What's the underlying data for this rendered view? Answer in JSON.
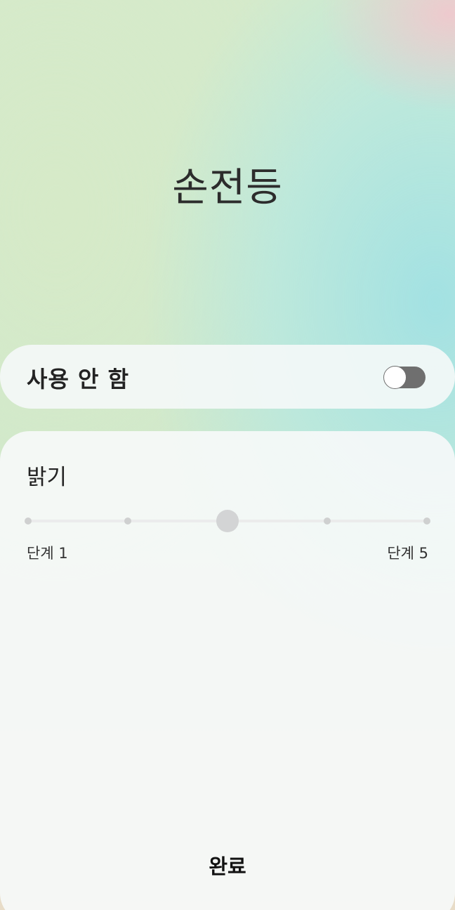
{
  "title": "손전등",
  "toggle": {
    "label": "사용 안 함",
    "state": "off",
    "track_color": "#6f6f6f"
  },
  "brightness": {
    "title": "밝기",
    "level_count": 5,
    "current_level": 3,
    "min_label": "단계 1",
    "max_label": "단계 5"
  },
  "done_label": "완료"
}
